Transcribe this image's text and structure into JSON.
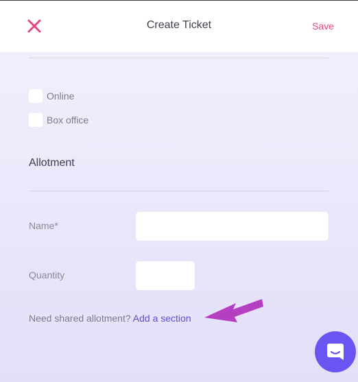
{
  "header": {
    "title": "Create Ticket",
    "save_label": "Save",
    "close_icon": "close-icon",
    "accent_color": "#e8457a"
  },
  "sales_channels": [
    {
      "label": "Online",
      "checked": false
    },
    {
      "label": "Box office",
      "checked": false
    }
  ],
  "allotment": {
    "section_title": "Allotment",
    "name_label": "Name*",
    "name_value": "",
    "quantity_label": "Quantity",
    "quantity_value": "",
    "helper_text": "Need shared allotment?",
    "helper_link": "Add a section"
  },
  "annotation": {
    "arrow_icon": "arrow-pointer-icon",
    "arrow_color": "#b43fc0"
  },
  "chat": {
    "icon": "chat-icon",
    "color": "#6a55f2"
  }
}
